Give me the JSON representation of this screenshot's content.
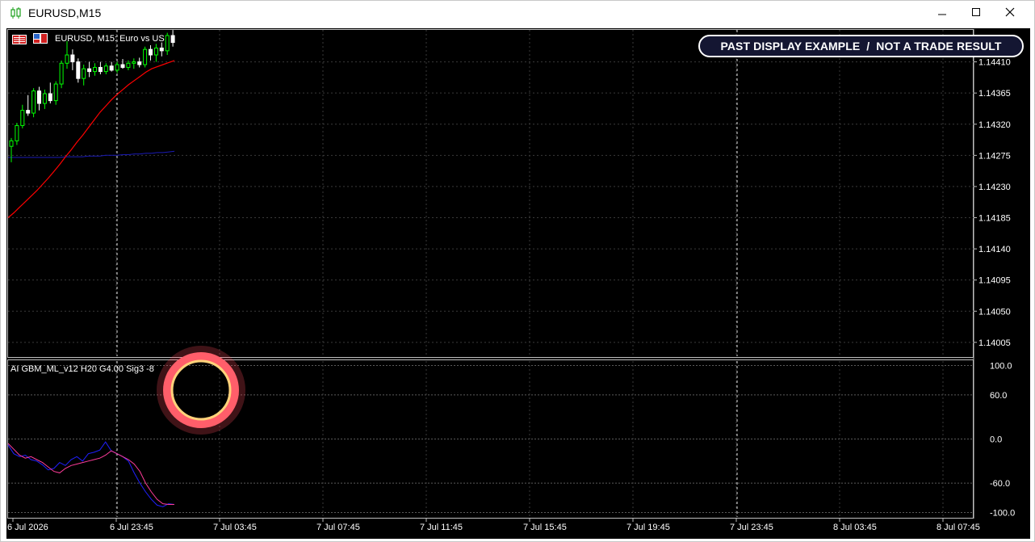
{
  "window": {
    "title": "EURUSD,M15",
    "icon": "candlestick-chart-icon",
    "controls": [
      "minimize-icon",
      "maximize-icon",
      "close-icon"
    ]
  },
  "chart_header": {
    "flag_icons": [
      "eu-flag-icon",
      "us-flag-icon"
    ],
    "symbol_text": "EURUSD, M15:  Euro vs US"
  },
  "banner": {
    "text": "PAST DISPLAY EXAMPLE  /  NOT A TRADE RESULT"
  },
  "indicator": {
    "label": "AI GBM_ML_v12 H20 G4.00 Sig3 -8"
  },
  "colors": {
    "background": "#000000",
    "bull_candle": "#00ff00",
    "bear_candle": "#ffffff",
    "ma_fast": "#ff0000",
    "ma_slow": "#1a1ab4",
    "osc_blue": "#2020ff",
    "osc_pink": "#ff3c9a",
    "highlight_ring": "#ff4c5c"
  },
  "chart_data": [
    {
      "type": "candlestick",
      "title": "EURUSD, M15:  Euro vs US",
      "y_ticks": [
        "1.14410",
        "1.14365",
        "1.14320",
        "1.14275",
        "1.14230",
        "1.14185",
        "1.14140",
        "1.14095",
        "1.14050",
        "1.14005"
      ],
      "x_ticks": [
        "6 Jul 2026",
        "6 Jul 23:45",
        "7 Jul 03:45",
        "7 Jul 07:45",
        "7 Jul 11:45",
        "7 Jul 15:45",
        "7 Jul 19:45",
        "7 Jul 23:45",
        "8 Jul 03:45",
        "8 Jul 07:45"
      ],
      "ylim": [
        1.13985,
        1.14455
      ],
      "grid": true,
      "candles": [
        [
          1.14288,
          1.143,
          1.14265,
          1.14296
        ],
        [
          1.14296,
          1.14322,
          1.1429,
          1.14318
        ],
        [
          1.14318,
          1.14348,
          1.14314,
          1.1434
        ],
        [
          1.1434,
          1.14362,
          1.14332,
          1.14336
        ],
        [
          1.14336,
          1.14372,
          1.1433,
          1.14368
        ],
        [
          1.14368,
          1.14374,
          1.1434,
          1.1435
        ],
        [
          1.1435,
          1.1437,
          1.14342,
          1.14364
        ],
        [
          1.14364,
          1.1438,
          1.1435,
          1.14354
        ],
        [
          1.14354,
          1.14382,
          1.14348,
          1.14378
        ],
        [
          1.14378,
          1.14412,
          1.14372,
          1.14408
        ],
        [
          1.14408,
          1.1444,
          1.144,
          1.1442
        ],
        [
          1.1442,
          1.14428,
          1.14398,
          1.1441
        ],
        [
          1.1441,
          1.14415,
          1.1438,
          1.14386
        ],
        [
          1.14386,
          1.14406,
          1.14376,
          1.144
        ],
        [
          1.144,
          1.1441,
          1.14388,
          1.14396
        ],
        [
          1.14396,
          1.14408,
          1.1439,
          1.14402
        ],
        [
          1.14402,
          1.1441,
          1.14392,
          1.14396
        ],
        [
          1.14396,
          1.14408,
          1.14392,
          1.14404
        ],
        [
          1.14404,
          1.1441,
          1.14396,
          1.14398
        ],
        [
          1.14398,
          1.1441,
          1.14394,
          1.14406
        ],
        [
          1.14406,
          1.14414,
          1.144,
          1.14402
        ],
        [
          1.14402,
          1.14412,
          1.14398,
          1.14408
        ],
        [
          1.14408,
          1.14415,
          1.144,
          1.1441
        ],
        [
          1.1441,
          1.14416,
          1.14402,
          1.14406
        ],
        [
          1.14406,
          1.14432,
          1.14402,
          1.14428
        ],
        [
          1.14428,
          1.14434,
          1.14412,
          1.1442
        ],
        [
          1.1442,
          1.14436,
          1.1441,
          1.1443
        ],
        [
          1.1443,
          1.14438,
          1.14418,
          1.14426
        ],
        [
          1.14426,
          1.14452,
          1.1442,
          1.14448
        ],
        [
          1.14448,
          1.14456,
          1.14432,
          1.14438
        ]
      ],
      "ma_fast": [
        1.14185,
        1.14192,
        1.142,
        1.14208,
        1.14216,
        1.14224,
        1.14233,
        1.14242,
        1.14252,
        1.14262,
        1.14273,
        1.14283,
        1.14294,
        1.14304,
        1.14315,
        1.14326,
        1.14337,
        1.14346,
        1.14355,
        1.14363,
        1.1437,
        1.14377,
        1.14383,
        1.14389,
        1.14395,
        1.144,
        1.14403,
        1.14406,
        1.14409,
        1.14412
      ],
      "ma_slow": [
        1.14272,
        1.14272,
        1.14272,
        1.14272,
        1.14272,
        1.14272,
        1.14272,
        1.14272,
        1.14272,
        1.14272,
        1.14273,
        1.14273,
        1.14273,
        1.14273,
        1.14274,
        1.14274,
        1.14274,
        1.14275,
        1.14275,
        1.14275,
        1.14276,
        1.14276,
        1.14277,
        1.14277,
        1.14278,
        1.14278,
        1.14279,
        1.14279,
        1.1428,
        1.14281
      ]
    },
    {
      "type": "line",
      "title": "AI GBM_ML_v12 H20 G4.00 Sig3 -8",
      "y_ticks": [
        "100.0",
        "60.0",
        "0.0",
        "-60.0",
        "-100.0"
      ],
      "ylim": [
        -106,
        106
      ],
      "grid_levels": [
        100,
        60,
        0,
        -60,
        -100
      ],
      "series": [
        {
          "values": [
            -8,
            -20,
            -24,
            -22,
            -28,
            -30,
            -35,
            -42,
            -40,
            -32,
            -36,
            -28,
            -24,
            -30,
            -20,
            -18,
            -15,
            -4,
            -16,
            -20,
            -24,
            -30,
            -46,
            -60,
            -72,
            -82,
            -90,
            -92,
            -88,
            -89
          ]
        },
        {
          "values": [
            -6,
            -14,
            -22,
            -26,
            -24,
            -28,
            -32,
            -38,
            -44,
            -46,
            -40,
            -36,
            -34,
            -32,
            -30,
            -28,
            -26,
            -22,
            -16,
            -20,
            -24,
            -28,
            -34,
            -44,
            -60,
            -72,
            -82,
            -88,
            -89,
            -89
          ]
        }
      ]
    }
  ]
}
